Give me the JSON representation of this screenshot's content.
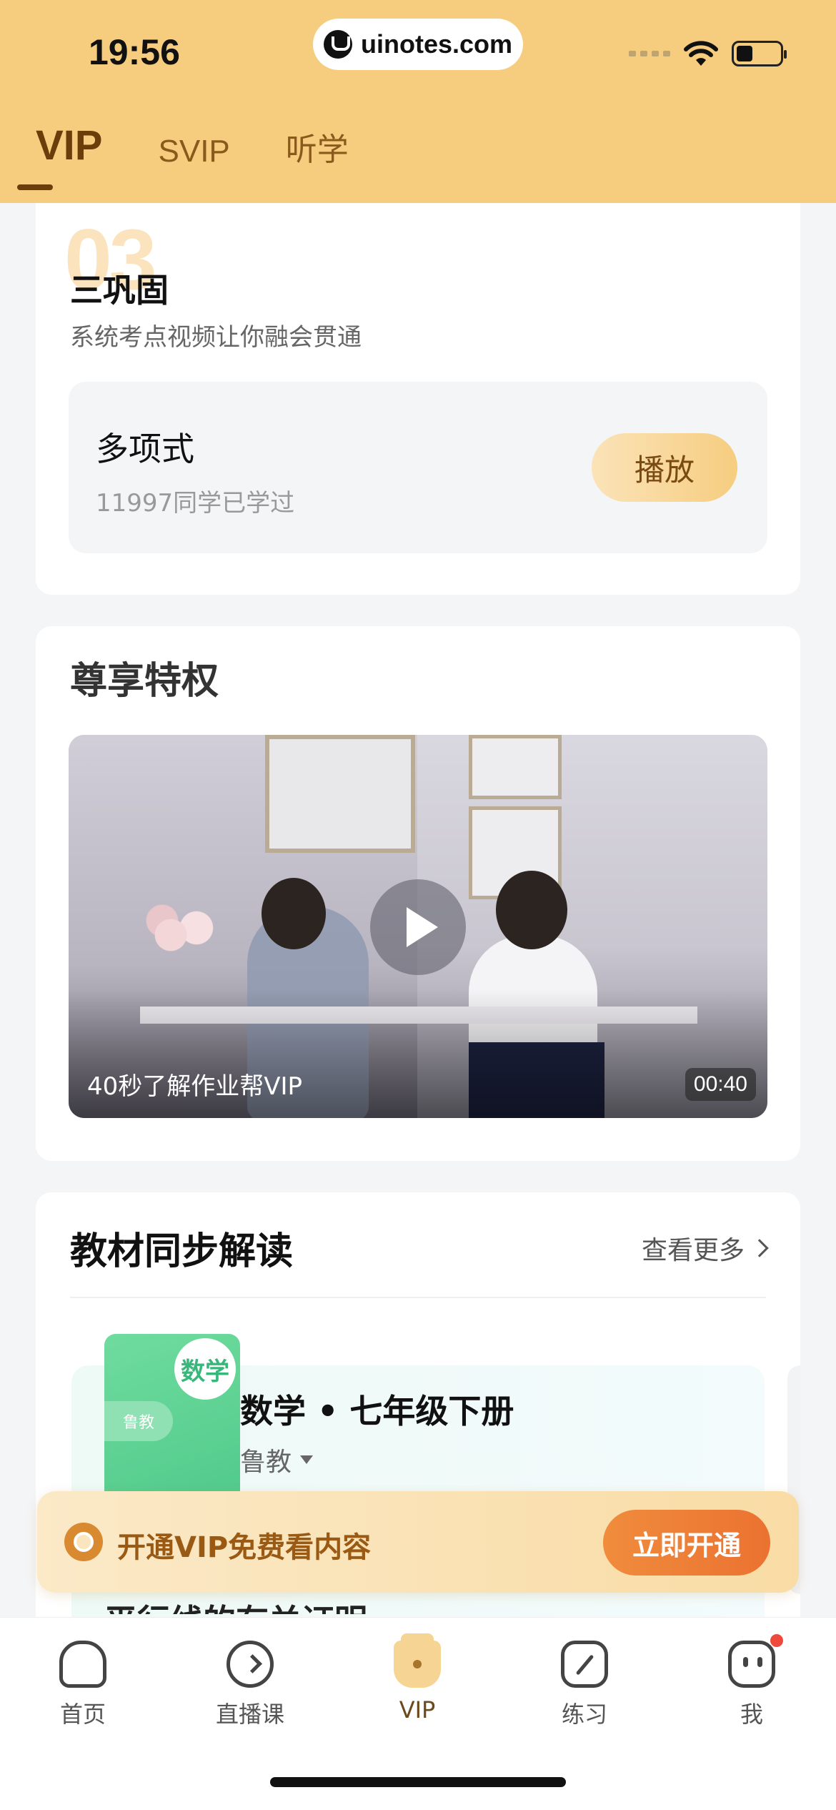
{
  "status_bar": {
    "time": "19:56",
    "url": "uinotes.com"
  },
  "tabs": [
    {
      "label": "VIP",
      "active": true
    },
    {
      "label": "SVIP",
      "active": false
    },
    {
      "label": "听学",
      "active": false
    }
  ],
  "step_section": {
    "number": "03",
    "title": "三巩固",
    "subtitle": "系统考点视频让你融会贯通",
    "lesson": {
      "title": "多项式",
      "count": "11997同学已学过",
      "play_label": "播放"
    }
  },
  "privilege_section": {
    "title": "尊享特权",
    "video": {
      "caption": "40秒了解作业帮VIP",
      "duration": "00:40"
    }
  },
  "textbook_section": {
    "title": "教材同步解读",
    "more_label": "查看更多",
    "book": {
      "subject_badge": "数学",
      "publisher_badge": "鲁教",
      "title": "数学 • 七年级下册",
      "publisher": "鲁教"
    },
    "next_item_peek": "平行线的有关证明"
  },
  "vip_banner": {
    "text": "开通VIP免费看内容",
    "button_label": "立即开通"
  },
  "bottom_nav": [
    {
      "label": "首页",
      "icon": "home-icon"
    },
    {
      "label": "直播课",
      "icon": "live-icon"
    },
    {
      "label": "VIP",
      "icon": "vip-crown-icon",
      "active": true
    },
    {
      "label": "练习",
      "icon": "practice-icon"
    },
    {
      "label": "我",
      "icon": "profile-icon",
      "badge": true
    }
  ],
  "colors": {
    "header_bg": "#f6cd7e",
    "accent_orange": "#eb7231",
    "vip_brown": "#6b3d0a"
  }
}
